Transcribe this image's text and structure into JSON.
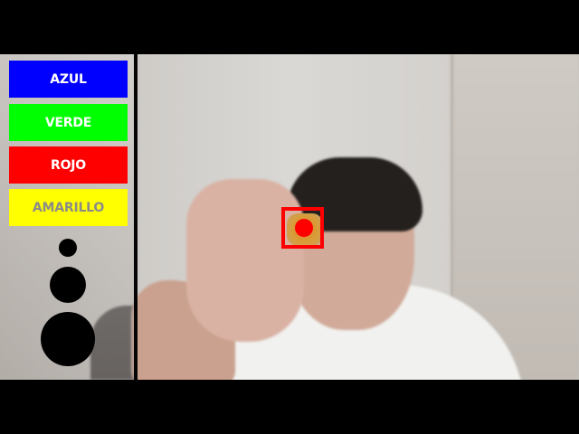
{
  "app": {
    "background": "#000000",
    "mode": "color-picker-camera-overlay"
  },
  "palette": {
    "buttons": [
      {
        "label": "AZUL",
        "color": "#0000ff",
        "text_color": "#ffffff"
      },
      {
        "label": "VERDE",
        "color": "#00ff00",
        "text_color": "#ffffff"
      },
      {
        "label": "ROJO",
        "color": "#ff0000",
        "text_color": "#ffffff"
      },
      {
        "label": "AMARILLO",
        "color": "#ffff00",
        "text_color": "#8a8a8a"
      }
    ]
  },
  "brush_sizes": [
    {
      "name": "small",
      "color": "#000000"
    },
    {
      "name": "medium",
      "color": "#000000"
    },
    {
      "name": "large",
      "color": "#000000"
    }
  ],
  "tracker": {
    "box_color": "#ff0000",
    "dot_color": "#ff0000",
    "tracked_object_color": "#d8962f"
  },
  "camera": {
    "subject": "person"
  }
}
